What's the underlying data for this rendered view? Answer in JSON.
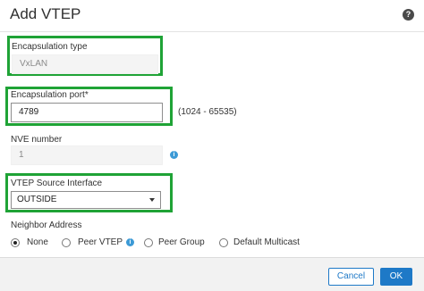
{
  "dialog": {
    "title": "Add VTEP",
    "help_icon": "question-circle-icon"
  },
  "encapsulation_type": {
    "label": "Encapsulation type",
    "value": "VxLAN"
  },
  "encapsulation_port": {
    "label": "Encapsulation port*",
    "value": "4789",
    "range_hint": "(1024 - 65535)"
  },
  "nve_number": {
    "label": "NVE number",
    "value": "1",
    "info_icon": "info-icon"
  },
  "vtep_source_interface": {
    "label": "VTEP Source Interface",
    "selected": "OUTSIDE"
  },
  "neighbor_address": {
    "label": "Neighbor Address",
    "options": [
      {
        "label": "None",
        "checked": true
      },
      {
        "label": "Peer VTEP",
        "checked": false
      },
      {
        "label": "Peer Group",
        "checked": false
      },
      {
        "label": "Default Multicast",
        "checked": false
      }
    ]
  },
  "footer": {
    "cancel_label": "Cancel",
    "ok_label": "OK"
  },
  "colors": {
    "highlight": "#1fa336",
    "primary": "#1e79c7",
    "info": "#3c9ad6"
  }
}
